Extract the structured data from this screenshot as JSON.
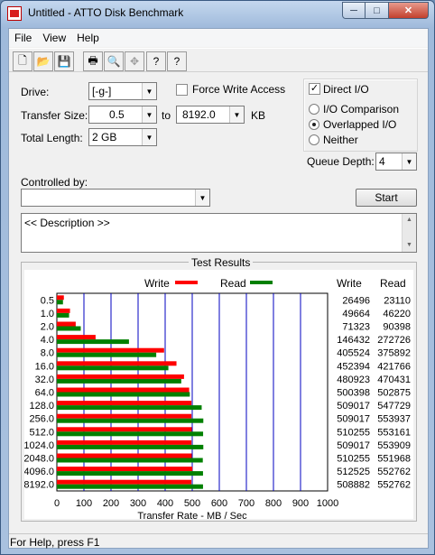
{
  "window": {
    "title": "Untitled - ATTO Disk Benchmark",
    "minimize": "─",
    "maximize": "□",
    "close": "✕"
  },
  "menu": [
    "File",
    "View",
    "Help"
  ],
  "toolbar": {
    "icons": [
      "new-icon",
      "open-icon",
      "save-icon",
      "print-icon",
      "print-preview-icon",
      "move-icon",
      "help-icon",
      "context-help-icon"
    ],
    "glyphs": [
      "🗋",
      "📂",
      "💾",
      "🖶",
      "🔍",
      "✥",
      "?",
      "?"
    ]
  },
  "form": {
    "drive_label": "Drive:",
    "drive_value": "[-g-]",
    "force_write_label": "Force Write Access",
    "force_write_checked": false,
    "direct_io_label": "Direct I/O",
    "direct_io_checked": true,
    "transfer_size_label": "Transfer Size:",
    "transfer_from": "0.5",
    "to_label": "to",
    "transfer_to": "8192.0",
    "unit": "KB",
    "total_length_label": "Total Length:",
    "total_length_value": "2 GB",
    "io_comparison_label": "I/O Comparison",
    "overlapped_io_label": "Overlapped I/O",
    "neither_label": "Neither",
    "io_mode_selected": "Overlapped I/O",
    "queue_depth_label": "Queue Depth:",
    "queue_depth_value": "4",
    "controlled_by_label": "Controlled by:",
    "controlled_by_value": "",
    "start_label": "Start",
    "description_text": "<< Description >>"
  },
  "results": {
    "title": "Test Results",
    "write_legend": "Write",
    "read_legend": "Read",
    "write_header": "Write",
    "read_header": "Read",
    "status": "For Help, press F1"
  },
  "chart_data": {
    "type": "bar",
    "orientation": "horizontal",
    "title": "Test Results",
    "xlabel": "Transfer Rate - MB / Sec",
    "ylabel": "",
    "xlim": [
      0,
      1000
    ],
    "xticks": [
      0,
      100,
      200,
      300,
      400,
      500,
      600,
      700,
      800,
      900,
      1000
    ],
    "categories": [
      "0.5",
      "1.0",
      "2.0",
      "4.0",
      "8.0",
      "16.0",
      "32.0",
      "64.0",
      "128.0",
      "256.0",
      "512.0",
      "1024.0",
      "2048.0",
      "4096.0",
      "8192.0"
    ],
    "series": [
      {
        "name": "Write",
        "color": "#ff0000",
        "values": [
          26496,
          49664,
          71323,
          146432,
          405524,
          452394,
          480923,
          500398,
          509017,
          509017,
          510255,
          509017,
          510255,
          512525,
          508882
        ]
      },
      {
        "name": "Read",
        "color": "#008000",
        "values": [
          23110,
          46220,
          90398,
          272726,
          375892,
          421766,
          470431,
          502875,
          547729,
          553937,
          553161,
          553909,
          551968,
          552762,
          552762
        ]
      }
    ],
    "gridlines": "vertical",
    "legend": "top"
  }
}
